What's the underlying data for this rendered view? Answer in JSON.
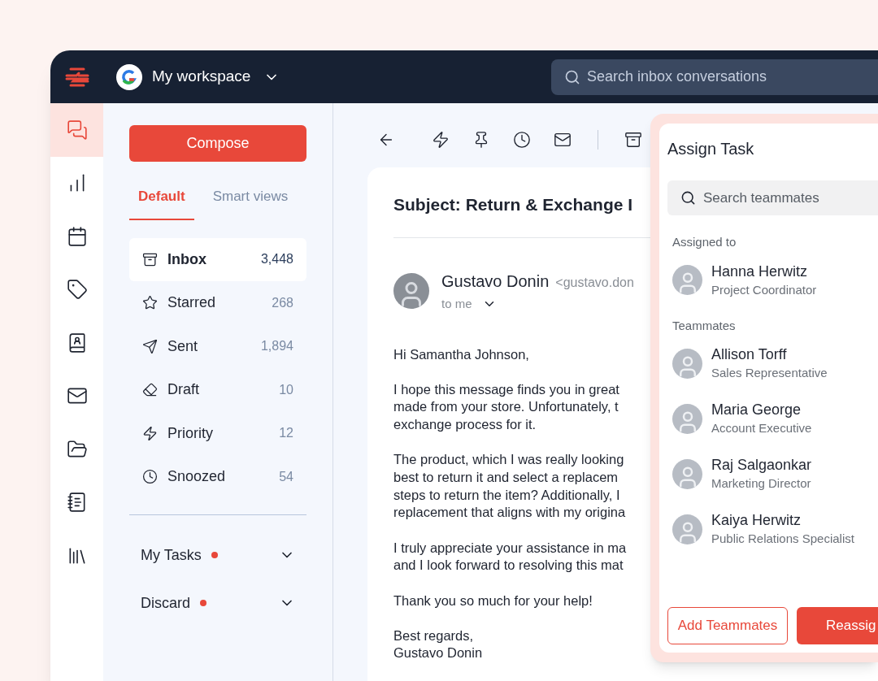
{
  "topbar": {
    "workspace": "My workspace",
    "search": {
      "placeholder": "Search inbox conversations"
    }
  },
  "rail": [
    {
      "selected": true
    },
    {
      "selected": false
    },
    {
      "selected": false
    },
    {
      "selected": false
    },
    {
      "selected": false
    },
    {
      "selected": false
    },
    {
      "selected": false
    },
    {
      "selected": false
    },
    {
      "selected": false
    }
  ],
  "compose": "Compose",
  "tabs": [
    {
      "label": "Default",
      "selected": true
    },
    {
      "label": "Smart views",
      "selected": false
    }
  ],
  "folders": [
    {
      "label": "Inbox",
      "count": "3,448",
      "selected": true
    },
    {
      "label": "Starred",
      "count": "268",
      "selected": false
    },
    {
      "label": "Sent",
      "count": "1,894",
      "selected": false
    },
    {
      "label": "Draft",
      "count": "10",
      "selected": false
    },
    {
      "label": "Priority",
      "count": "12",
      "selected": false
    },
    {
      "label": "Snoozed",
      "count": "54",
      "selected": false
    }
  ],
  "sections": [
    {
      "label": "My Tasks",
      "dot": true,
      "expanded": false
    },
    {
      "label": "Discard",
      "dot": true,
      "expanded": false
    }
  ],
  "email": {
    "subject": "Subject: Return & Exchange I",
    "sender": "Gustavo Donin",
    "sender_email": "<gustavo.don",
    "recipient": "to me",
    "paragraphs": [
      [
        "Hi Samantha Johnson,"
      ],
      [
        "I hope this message finds you in great",
        "made from your store. Unfortunately, t",
        "exchange process for it."
      ],
      [
        "The product, which I was really looking",
        "best to return it and select a replacem",
        "steps to return the item? Additionally, I",
        "replacement that aligns with my origina"
      ],
      [
        "I truly appreciate your assistance in ma",
        "and I look forward to resolving this mat"
      ],
      [
        "Thank you so much for your help!"
      ],
      [
        "Best regards,",
        "Gustavo Donin"
      ]
    ]
  },
  "assign_panel": {
    "title": "Assign Task",
    "search": {
      "placeholder": "Search teammates"
    },
    "groups": [
      {
        "label": "Assigned to",
        "people": [
          {
            "name": "Hanna Herwitz",
            "role": "Project Coordinator"
          }
        ]
      },
      {
        "label": "Teammates",
        "people": [
          {
            "name": "Allison Torff",
            "role": "Sales Representative"
          },
          {
            "name": "Maria George",
            "role": "Account Executive"
          },
          {
            "name": "Raj Salgaonkar",
            "role": "Marketing Director"
          },
          {
            "name": "Kaiya Herwitz",
            "role": "Public Relations Specialist"
          }
        ]
      }
    ],
    "buttons": [
      {
        "label": "Add Teammates",
        "kind": "outline"
      },
      {
        "label": "Reassig",
        "kind": "primary"
      }
    ]
  }
}
